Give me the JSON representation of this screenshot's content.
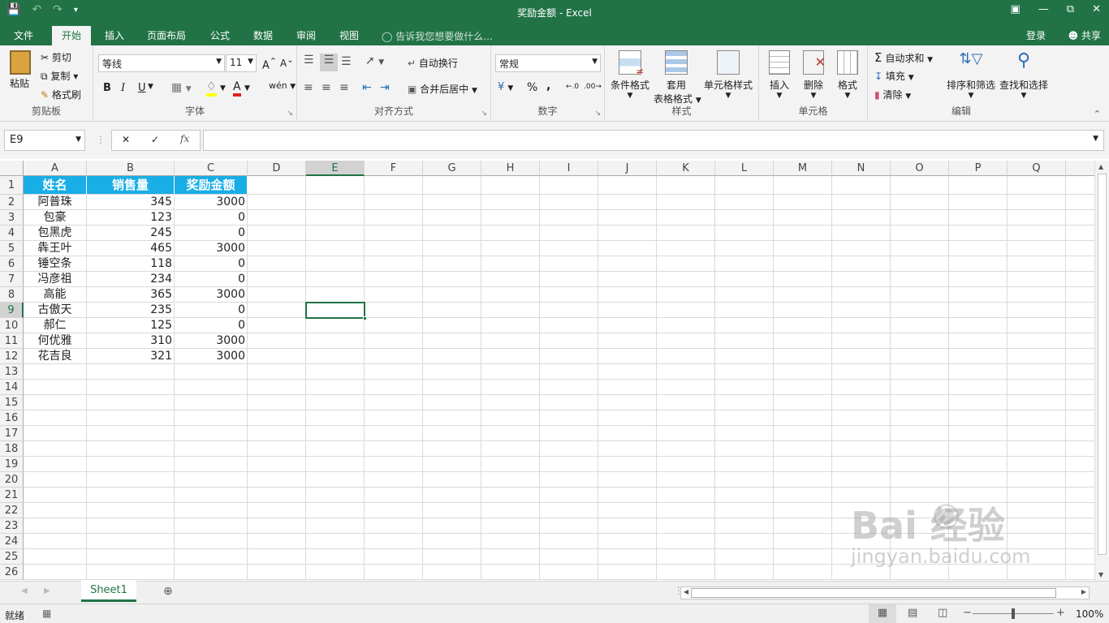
{
  "window": {
    "title": "奖励金额 - Excel"
  },
  "tabs": [
    "文件",
    "开始",
    "插入",
    "页面布局",
    "公式",
    "数据",
    "审阅",
    "视图"
  ],
  "tell_me": "告诉我您想要做什么...",
  "account": {
    "login": "登录",
    "share": "共享"
  },
  "clipboard": {
    "paste": "粘贴",
    "cut": "剪切",
    "copy": "复制",
    "format_painter": "格式刷",
    "label": "剪贴板"
  },
  "font": {
    "name": "等线",
    "size": "11",
    "label": "字体",
    "bold": "B",
    "italic": "I",
    "underline": "U"
  },
  "alignment": {
    "wrap": "自动换行",
    "merge": "合并后居中",
    "label": "对齐方式"
  },
  "number": {
    "format": "常规",
    "label": "数字",
    "percent": "%"
  },
  "styles": {
    "cond": "条件格式",
    "table1": "套用",
    "table2": "表格格式",
    "cell": "单元格样式",
    "label": "样式"
  },
  "cells": {
    "insert": "插入",
    "delete": "删除",
    "format": "格式",
    "label": "单元格"
  },
  "editing": {
    "autosum": "自动求和",
    "fill": "填充",
    "clear": "清除",
    "sort": "排序和筛选",
    "find": "查找和选择",
    "label": "编辑"
  },
  "name_box": "E9",
  "columns": [
    "A",
    "B",
    "C",
    "D",
    "E",
    "F",
    "G",
    "H",
    "I",
    "J",
    "K",
    "L",
    "M",
    "N",
    "O",
    "P",
    "Q"
  ],
  "rows": [
    "1",
    "2",
    "3",
    "4",
    "5",
    "6",
    "7",
    "8",
    "9",
    "10",
    "11",
    "12",
    "13",
    "14",
    "15",
    "16",
    "17",
    "18",
    "19",
    "20",
    "21",
    "22",
    "23",
    "24",
    "25",
    "26"
  ],
  "table": {
    "headers": [
      "姓名",
      "销售量",
      "奖励金额"
    ],
    "rows": [
      [
        "阿普珠",
        "345",
        "3000"
      ],
      [
        "包豪",
        "123",
        "0"
      ],
      [
        "包黑虎",
        "245",
        "0"
      ],
      [
        "犇王叶",
        "465",
        "3000"
      ],
      [
        "锤空条",
        "118",
        "0"
      ],
      [
        "冯彦祖",
        "234",
        "0"
      ],
      [
        "高能",
        "365",
        "3000"
      ],
      [
        "古傲天",
        "235",
        "0"
      ],
      [
        "郝仁",
        "125",
        "0"
      ],
      [
        "何优雅",
        "310",
        "3000"
      ],
      [
        "花吉良",
        "321",
        "3000"
      ]
    ]
  },
  "sheet_tab": "Sheet1",
  "status": {
    "ready": "就绪",
    "zoom": "100%"
  },
  "watermark": {
    "brand": "Bai 经验",
    "url": "jingyan.baidu.com"
  },
  "colors": {
    "excel_green": "#217346",
    "header_fill": "#19aee5"
  }
}
